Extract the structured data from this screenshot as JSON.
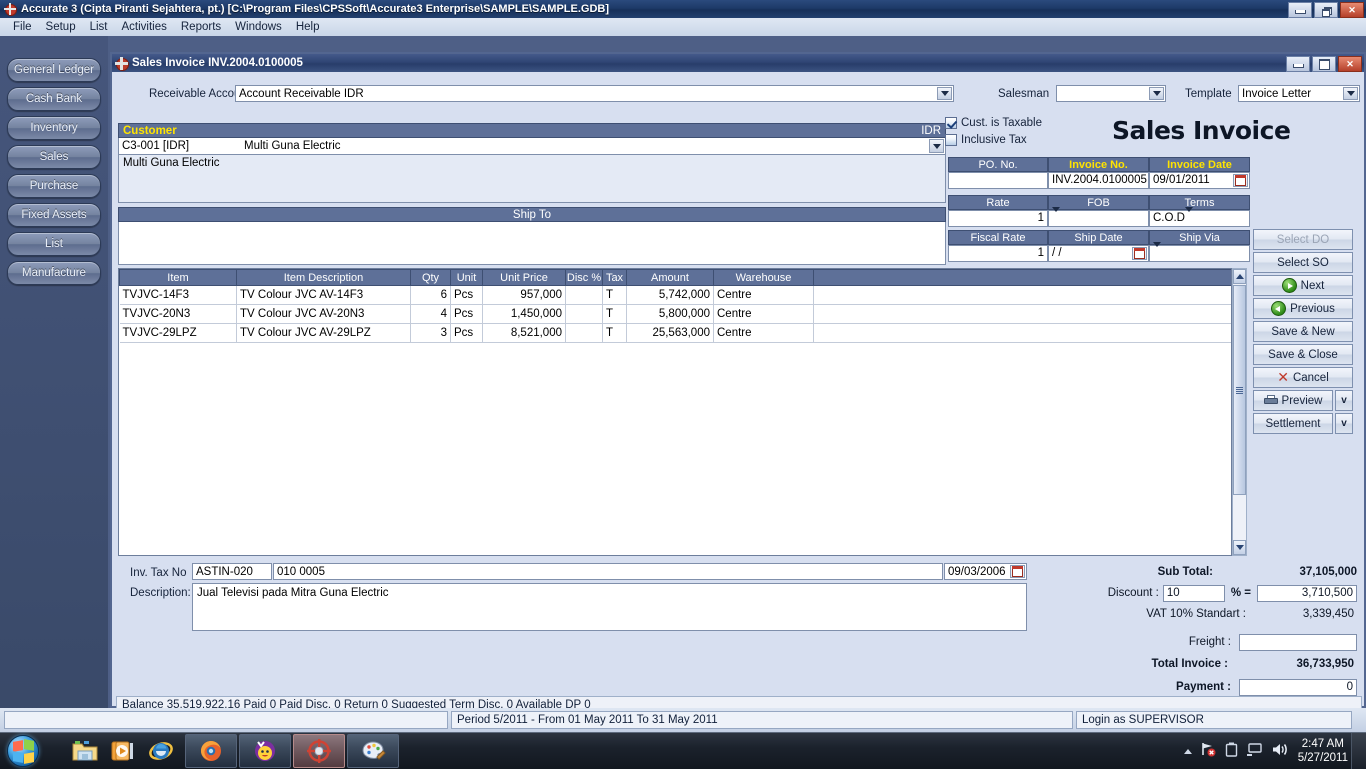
{
  "window": {
    "app_title": "Accurate 3  (Cipta Piranti Sejahtera, pt.)  [C:\\Program Files\\CPSSoft\\Accurate3 Enterprise\\SAMPLE\\SAMPLE.GDB]",
    "inner_title": "Sales Invoice INV.2004.0100005"
  },
  "menu": {
    "items": [
      {
        "label": "File"
      },
      {
        "label": "Setup"
      },
      {
        "label": "List"
      },
      {
        "label": "Activities"
      },
      {
        "label": "Reports"
      },
      {
        "label": "Windows"
      },
      {
        "label": "Help"
      }
    ]
  },
  "sidebar": {
    "items": [
      {
        "label": "General Ledger"
      },
      {
        "label": "Cash Bank"
      },
      {
        "label": "Inventory"
      },
      {
        "label": "Sales"
      },
      {
        "label": "Purchase"
      },
      {
        "label": "Fixed Assets"
      },
      {
        "label": "List"
      },
      {
        "label": "Manufacture"
      }
    ]
  },
  "form": {
    "receivable_account_label": "Receivable Account",
    "receivable_account_value": "Account Receivable IDR",
    "salesman_label": "Salesman",
    "salesman_value": "",
    "template_label": "Template",
    "template_value": "Invoice Letter",
    "doc_title": "Sales Invoice",
    "customer": {
      "header_label": "Customer",
      "currency_label": "IDR",
      "code": "C3-001 [IDR]",
      "name": "Multi Guna Electric",
      "address": "Multi Guna Electric"
    },
    "ship_to": {
      "header_label": "Ship To",
      "value": ""
    },
    "checkboxes": {
      "cust_taxable_label": "Cust. is Taxable",
      "cust_taxable_checked": true,
      "inclusive_tax_label": "Inclusive Tax",
      "inclusive_tax_checked": false
    },
    "fields": {
      "po_no_label": "PO. No.",
      "po_no_value": "",
      "invoice_no_label": "Invoice No.",
      "invoice_no_value": "INV.2004.0100005",
      "invoice_date_label": "Invoice Date",
      "invoice_date_value": "09/01/2011",
      "rate_label": "Rate",
      "rate_value": "1",
      "fob_label": "FOB",
      "fob_value": "",
      "terms_label": "Terms",
      "terms_value": "C.O.D",
      "fiscal_rate_label": "Fiscal Rate",
      "fiscal_rate_value": "1",
      "ship_date_label": "Ship Date",
      "ship_date_value": "/  /",
      "ship_via_label": "Ship Via",
      "ship_via_value": ""
    }
  },
  "items_grid": {
    "columns": [
      "Item",
      "Item Description",
      "Qty",
      "Unit",
      "Unit Price",
      "Disc %",
      "Tax",
      "Amount",
      "Warehouse"
    ],
    "rows": [
      {
        "item": "TVJVC-14F3",
        "description": "TV Colour JVC AV-14F3",
        "qty": "6",
        "unit": "Pcs",
        "unit_price": "957,000",
        "disc": "",
        "tax": "T",
        "amount": "5,742,000",
        "warehouse": "Centre"
      },
      {
        "item": "TVJVC-20N3",
        "description": "TV Colour JVC AV-20N3",
        "qty": "4",
        "unit": "Pcs",
        "unit_price": "1,450,000",
        "disc": "",
        "tax": "T",
        "amount": "5,800,000",
        "warehouse": "Centre"
      },
      {
        "item": "TVJVC-29LPZ",
        "description": "TV Colour JVC AV-29LPZ",
        "qty": "3",
        "unit": "Pcs",
        "unit_price": "8,521,000",
        "disc": "",
        "tax": "T",
        "amount": "25,563,000",
        "warehouse": "Centre"
      }
    ]
  },
  "actions": {
    "select_do": "Select DO",
    "select_so": "Select SO",
    "next": "Next",
    "previous": "Previous",
    "save_new": "Save & New",
    "save_close": "Save & Close",
    "cancel": "Cancel",
    "preview": "Preview",
    "settlement": "Settlement",
    "dropdown_glyph": "v"
  },
  "bottom": {
    "inv_tax_no_label": "Inv. Tax No",
    "inv_tax_no_prefix": "ASTIN-020",
    "inv_tax_no_value": "010 0005",
    "inv_tax_date": "09/03/2006",
    "description_label": "Description:",
    "description_value": "Jual Televisi pada Mitra Guna Electric"
  },
  "totals": {
    "sub_total_label": "Sub Total",
    "sub_total_value": "37,105,000",
    "discount_label": "Discount :",
    "discount_percent": "10",
    "percent_eq_label": "% =",
    "discount_value": "3,710,500",
    "vat_label": "VAT 10% Standart :",
    "vat_value": "3,339,450",
    "freight_label": "Freight :",
    "freight_value": "",
    "total_invoice_label": "Total Invoice :",
    "total_invoice_value": "36,733,950",
    "payment_label": "Payment :",
    "payment_value": "0"
  },
  "form_status": {
    "text": "Balance 35,519,922.16  Paid 0  Paid Disc. 0  Return 0  Suggested Term Disc. 0  Available DP 0"
  },
  "app_status": {
    "period": "Period 5/2011 - From 01 May 2011 To 31 May 2011",
    "login": "Login as SUPERVISOR"
  },
  "taskbar": {
    "icons": [
      "start-orb",
      "explorer-icon",
      "media-player-icon",
      "internet-explorer-icon",
      "firefox-icon",
      "yahoo-messenger-icon",
      "accurate-icon",
      "paint-icon"
    ],
    "tray": [
      "network-error-icon",
      "battery-icon",
      "display-icon",
      "volume-icon"
    ],
    "time": "2:47 AM",
    "date": "5/27/2011"
  },
  "colors": {
    "titlebar": "#1d3a68",
    "panel_header": "#5e7098",
    "accent_yellow": "#ffe400",
    "sidebar_bg": "#46567c"
  }
}
